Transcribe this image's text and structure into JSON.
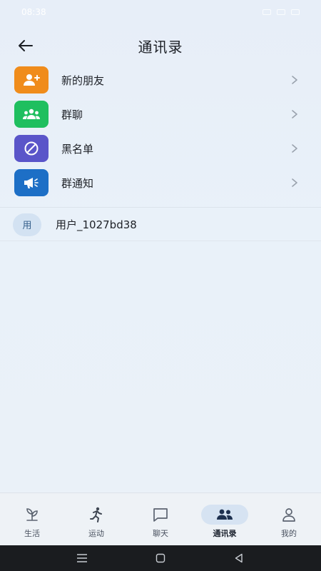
{
  "status_bar": {
    "time": "08:38"
  },
  "header": {
    "title": "通讯录"
  },
  "menu": [
    {
      "label": "新的朋友",
      "color": "#f08c1b",
      "icon": "add-user-icon"
    },
    {
      "label": "群聊",
      "color": "#1fbf5f",
      "icon": "group-icon"
    },
    {
      "label": "黑名单",
      "color": "#5a55c9",
      "icon": "block-icon"
    },
    {
      "label": "群通知",
      "color": "#1d6fc6",
      "icon": "megaphone-icon"
    }
  ],
  "contacts": [
    {
      "avatar_text": "用",
      "name": "用户_1027bd38"
    }
  ],
  "tabs": [
    {
      "label": "生活",
      "icon": "sprout-icon",
      "active": false
    },
    {
      "label": "运动",
      "icon": "running-icon",
      "active": false
    },
    {
      "label": "聊天",
      "icon": "chat-icon",
      "active": false
    },
    {
      "label": "通讯录",
      "icon": "contacts-icon",
      "active": true
    },
    {
      "label": "我的",
      "icon": "person-icon",
      "active": false
    }
  ],
  "colors": {
    "accent": "#d6e3f2",
    "background": "#e9f0f8"
  }
}
